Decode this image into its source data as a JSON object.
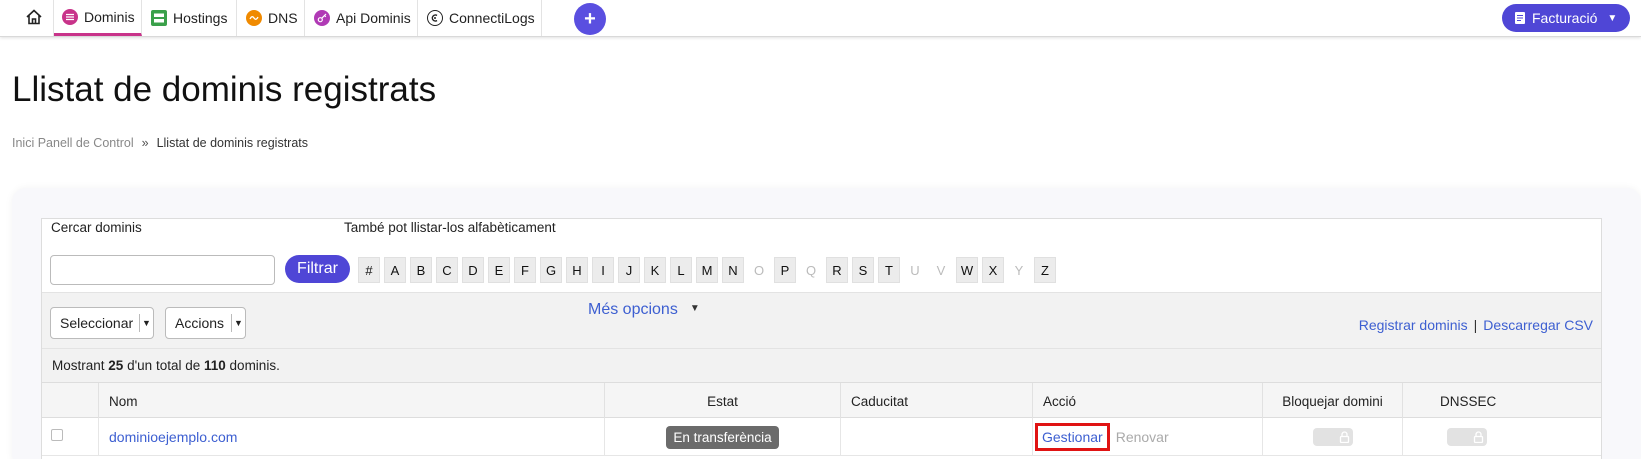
{
  "nav": {
    "items": [
      {
        "label": "Dominis",
        "icon": "dominis-icon",
        "active": true
      },
      {
        "label": "Hostings",
        "icon": "server-icon"
      },
      {
        "label": "DNS",
        "icon": "dns-icon"
      },
      {
        "label": "Api Dominis",
        "icon": "key-icon"
      },
      {
        "label": "ConnectiLogs",
        "icon": "connectilogs-icon"
      }
    ],
    "plus_label": "+",
    "billing_label": "Facturació"
  },
  "page": {
    "title": "Llistat de dominis registrats",
    "breadcrumb": {
      "home": "Inici Panell de Control",
      "separator": "»",
      "current": "Llistat de dominis registrats"
    }
  },
  "search": {
    "label": "Cercar dominis",
    "placeholder": "",
    "button": "Filtrar",
    "alpha_label": "També pot llistar-los alfabèticament",
    "letters": [
      {
        "l": "#",
        "on": true
      },
      {
        "l": "A",
        "on": true
      },
      {
        "l": "B",
        "on": true
      },
      {
        "l": "C",
        "on": true
      },
      {
        "l": "D",
        "on": true
      },
      {
        "l": "E",
        "on": true
      },
      {
        "l": "F",
        "on": true
      },
      {
        "l": "G",
        "on": true
      },
      {
        "l": "H",
        "on": true
      },
      {
        "l": "I",
        "on": true
      },
      {
        "l": "J",
        "on": true
      },
      {
        "l": "K",
        "on": true
      },
      {
        "l": "L",
        "on": true
      },
      {
        "l": "M",
        "on": true
      },
      {
        "l": "N",
        "on": true
      },
      {
        "l": "O",
        "on": false
      },
      {
        "l": "P",
        "on": true
      },
      {
        "l": "Q",
        "on": false
      },
      {
        "l": "R",
        "on": true
      },
      {
        "l": "S",
        "on": true
      },
      {
        "l": "T",
        "on": true
      },
      {
        "l": "U",
        "on": false
      },
      {
        "l": "V",
        "on": false
      },
      {
        "l": "W",
        "on": true
      },
      {
        "l": "X",
        "on": true
      },
      {
        "l": "Y",
        "on": false
      },
      {
        "l": "Z",
        "on": true
      }
    ]
  },
  "toolbar": {
    "select_label": "Seleccionar",
    "actions_label": "Accions",
    "more_options": "Més opcions",
    "register_link": "Registrar dominis",
    "link_separator": "|",
    "download_link": "Descarregar CSV"
  },
  "count": {
    "prefix": "Mostrant",
    "shown": "25",
    "middle": "d'un total de",
    "total": "110",
    "suffix": "dominis."
  },
  "table": {
    "headers": {
      "name": "Nom",
      "status": "Estat",
      "expiry": "Caducitat",
      "action": "Acció",
      "lock": "Bloquejar domini",
      "dnssec": "DNSSEC"
    },
    "rows": [
      {
        "name": "dominioejemplo.com",
        "status": "En transferència",
        "expiry": "",
        "manage": "Gestionar",
        "renew": "Renovar"
      }
    ]
  },
  "colors": {
    "accent": "#4f46d6",
    "link": "#3d5fd1",
    "active_tab": "#c8338a",
    "highlight": "#e01313"
  }
}
